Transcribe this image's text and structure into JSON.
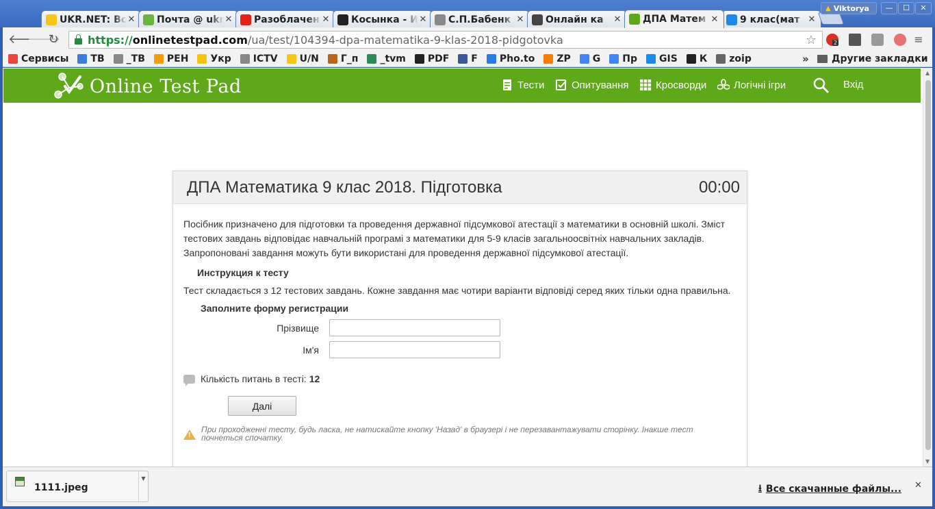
{
  "browser": {
    "tabs": [
      {
        "title": "UKR.NET: Вс",
        "icon": "ukrnet-icon",
        "color": "#f5c518"
      },
      {
        "title": "Почта @ ukr",
        "icon": "mail-icon",
        "color": "#6cb33f"
      },
      {
        "title": "Разоблачен",
        "icon": "youtube-icon",
        "color": "#e62117"
      },
      {
        "title": "Косынка - И",
        "icon": "spade-icon",
        "color": "#222222"
      },
      {
        "title": "С.П.Бабенк",
        "icon": "document-icon",
        "color": "#888888"
      },
      {
        "title": "Онлайн ка",
        "icon": "calculator-icon",
        "color": "#444444"
      },
      {
        "title": "ДПА Матем",
        "icon": "onlinetestpad-icon",
        "color": "#5ea81a"
      },
      {
        "title": "9 клас(мат",
        "icon": "spreadsheet-icon",
        "color": "#1e88e5"
      }
    ],
    "profile_name": "Viktorya",
    "url": {
      "scheme": "https://",
      "host": "onlinetestpad.com",
      "path": "/ua/test/104394-dpa-matematika-9-klas-2018-pidgotovka"
    },
    "extension_badge": "2",
    "bookmarks": [
      {
        "label": "Сервисы",
        "color": "#e8453c"
      },
      {
        "label": "ТВ",
        "color": "#3b7dd8"
      },
      {
        "label": "_ТВ",
        "color": "#888888"
      },
      {
        "label": "РЕН",
        "color": "#f39c12"
      },
      {
        "label": "Укр",
        "color": "#f1c40f"
      },
      {
        "label": "ICTV",
        "color": "#888888"
      },
      {
        "label": "U/N",
        "color": "#f5c518"
      },
      {
        "label": "Г_п",
        "color": "#b5651d"
      },
      {
        "label": "_tvm",
        "color": "#2e8b57"
      },
      {
        "label": "PDF",
        "color": "#222222"
      },
      {
        "label": "F",
        "color": "#3b5998"
      },
      {
        "label": "Pho.to",
        "color": "#2c7be5"
      },
      {
        "label": "ZP",
        "color": "#f57d00"
      },
      {
        "label": "G",
        "color": "#4285f4"
      },
      {
        "label": "Пр",
        "color": "#4285f4"
      },
      {
        "label": "GIS",
        "color": "#1e88e5"
      },
      {
        "label": "К",
        "color": "#222222"
      },
      {
        "label": "zoip",
        "color": "#666666"
      }
    ],
    "bookmarks_more": "»",
    "other_bookmarks": "Другие закладки"
  },
  "site": {
    "logo_text": "Online Test Pad",
    "header_color": "#5ea81a",
    "nav": [
      {
        "label": "Тести",
        "icon": "test-icon"
      },
      {
        "label": "Опитування",
        "icon": "survey-icon"
      },
      {
        "label": "Кросворди",
        "icon": "crossword-icon"
      },
      {
        "label": "Логічні ігри",
        "icon": "logic-games-icon"
      }
    ],
    "login": "Вхід"
  },
  "test": {
    "title": "ДПА Математика 9 клас 2018. Підготовка",
    "timer": "00:00",
    "intro": "Посібник призначено для підготовки та проведення державної підсумкової атестації з математики в основній школі. Зміст тестових завдань відповідає навчальній програмі з математики для 5-9 класів загальноосвітніх навчальних закладів. Запропоновані завдання можуть бути використані для проведення державної підсумкової атестації.",
    "instructions_heading": "Инструкция к тесту",
    "instructions": "Тест складається з 12 тестових завдань. Кожне завдання має чотири варіанти відповіді серед яких тільки одна правильна.",
    "form_heading": "Заполните форму регистрации",
    "fields": {
      "surname_label": "Прізвище",
      "surname_value": "",
      "name_label": "Ім'я",
      "name_value": ""
    },
    "question_count_label": "Кількість питань в тесті:",
    "question_count": "12",
    "next_button": "Далі",
    "warning": "При проходженні тесту, будь ласка, не натискайте кнопку 'Назад' в браузері і не перезавантажувати сторінку. Інакше тест почнеться спочатку."
  },
  "downloads": {
    "file_name": "1111.jpeg",
    "all_downloads": "Все скачанные файлы..."
  }
}
